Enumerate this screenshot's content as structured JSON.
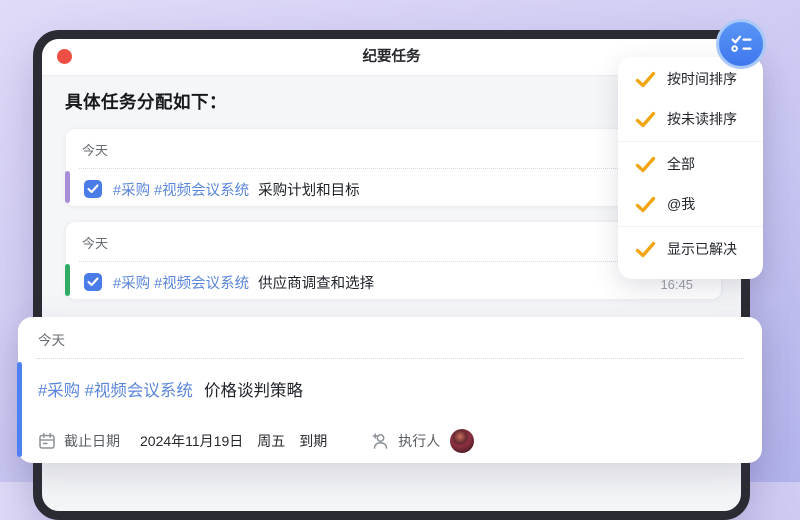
{
  "window": {
    "title": "纪要任务",
    "heading": "具体任务分配如下："
  },
  "task_groups": [
    {
      "date": "今天",
      "tags": "#采购 #视频会议系统",
      "title": "采购计划和目标",
      "accent": "#a98fd9",
      "checked": true
    },
    {
      "date": "今天",
      "tags": "#采购 #视频会议系统",
      "title": "供应商调查和选择",
      "accent": "#2fab63",
      "checked": true,
      "time": "16:45"
    }
  ],
  "menu": {
    "items": [
      {
        "label": "按时间排序"
      },
      {
        "label": "按未读排序"
      },
      {
        "label": "全部"
      },
      {
        "label": "@我"
      },
      {
        "label": "显示已解决"
      }
    ]
  },
  "detail_card": {
    "date": "今天",
    "tags": "#采购 #视频会议系统",
    "title": "价格谈判策略",
    "due_label": "截止日期",
    "due_date": "2024年11月19日",
    "due_day": "周五",
    "due_status": "到期",
    "assignee_label": "执行人"
  },
  "colors": {
    "traffic_red": "#ee4f44",
    "checkbox_blue": "#4a7ce8",
    "tag_blue": "#5b86db",
    "menu_check_orange": "#f1a512",
    "detail_bar_blue": "#4f80f2"
  }
}
